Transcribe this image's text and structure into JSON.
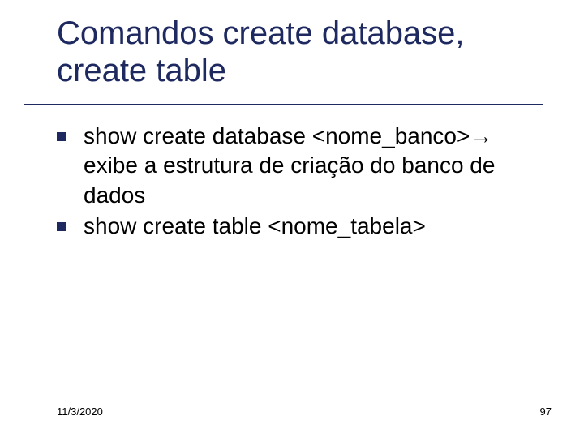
{
  "title": "Comandos create database, create table",
  "bullets": [
    "show create database <nome_banco>→ exibe a estrutura de criação do banco de dados",
    "show create table <nome_tabela>"
  ],
  "footer": {
    "date": "11/3/2020",
    "page": "97"
  }
}
